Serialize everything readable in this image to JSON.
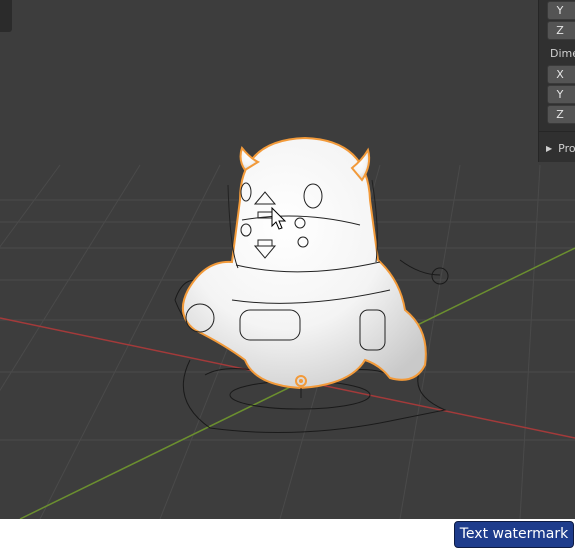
{
  "viewport": {
    "background": "#3d3d3d",
    "x_axis_color": "#a33a3a",
    "y_axis_color": "#6b8f2f",
    "selection_outline_color": "#f29a3a",
    "cursor_icon": "mouse-pointer-icon"
  },
  "n_panel": {
    "location_fields": [
      "Y",
      "Z"
    ],
    "dimensions_label": "Dime",
    "dimension_fields": [
      "X",
      "Y",
      "Z"
    ],
    "properties_subpanel": "Pro"
  },
  "watermark": {
    "label": "Text watermark"
  }
}
